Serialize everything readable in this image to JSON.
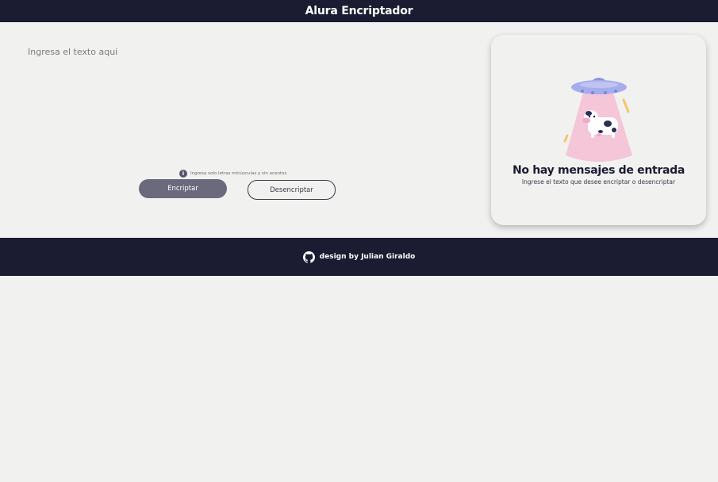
{
  "header": {
    "title": "Alura Encriptador"
  },
  "input": {
    "placeholder": "Ingresa el texto aqui",
    "value": ""
  },
  "hint": {
    "icon": "info-icon",
    "text": "Ingresa solo letras minúsculas y sin acentos"
  },
  "buttons": {
    "encrypt_label": "Encriptar",
    "decrypt_label": "Desencriptar"
  },
  "output": {
    "illustration": "ufo-abducting-cow",
    "title": "No hay mensajes de entrada",
    "subtitle": "Ingrese el texto que desee encriptar o desencriptar"
  },
  "footer": {
    "icon": "github-icon",
    "credit": "design by Julian Giraldo"
  },
  "colors": {
    "dark": "#1b1c31",
    "background": "#f1f1f0",
    "button_primary": "#6a6a7c",
    "ufo": "#9fa6e8",
    "beam": "#f4c6d8",
    "sparks": "#f6c56b"
  }
}
